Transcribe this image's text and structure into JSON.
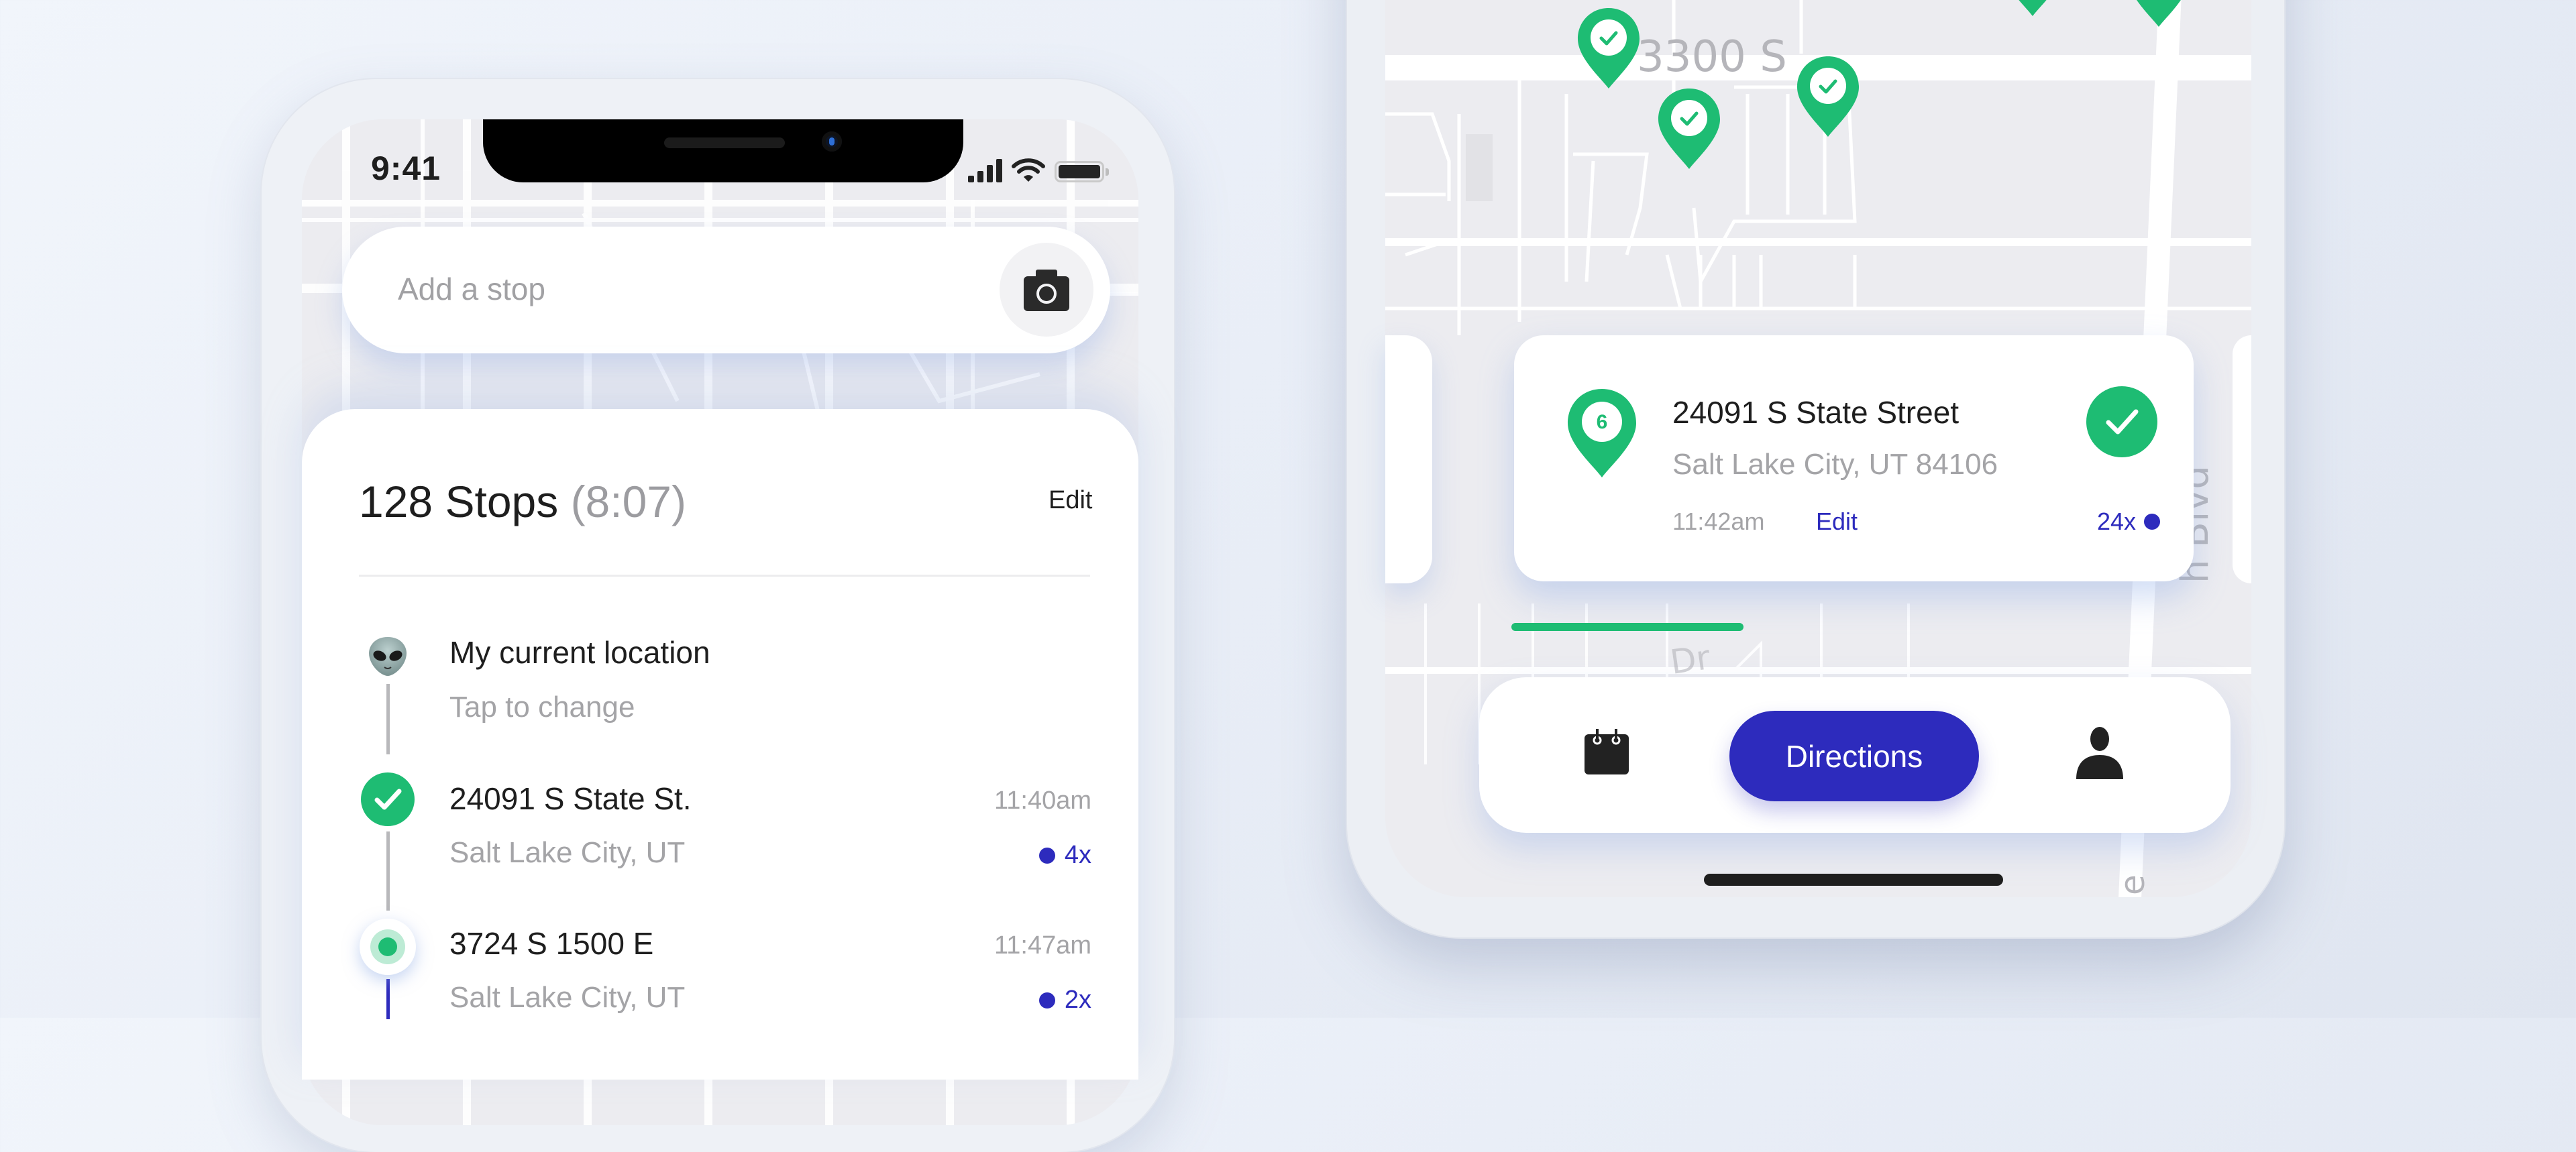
{
  "colors": {
    "accent": "#2d2bbd",
    "success": "#1ebc73",
    "text_primary": "#1e1e1e",
    "text_muted": "#a4a4a7"
  },
  "left_phone": {
    "status_bar": {
      "time": "9:41",
      "icons": [
        "cellular-signal-icon",
        "wifi-icon",
        "battery-icon"
      ]
    },
    "search": {
      "placeholder": "Add a stop",
      "camera_icon": "camera-icon"
    },
    "route": {
      "stops_count": "128 Stops",
      "duration": "(8:07)",
      "edit_label": "Edit"
    },
    "stops": [
      {
        "icon": "alien-emoji-icon",
        "title": "My current location",
        "subtitle": "Tap to change",
        "time": "",
        "count": ""
      },
      {
        "icon": "check-circle-icon",
        "title": "24091 S State St.",
        "subtitle": "Salt Lake City, UT",
        "time": "11:40am",
        "count": "4x"
      },
      {
        "icon": "current-stop-dot-icon",
        "title": "3724 S 1500 E",
        "subtitle": "Salt Lake City, UT",
        "time": "11:47am",
        "count": "2x"
      }
    ]
  },
  "right_phone": {
    "map": {
      "labels": [
        "3300 S",
        "Dr",
        "h Blvd",
        "e"
      ],
      "completed_pins": 6
    },
    "stop_card": {
      "pin_number": "6",
      "title": "24091 S State Street",
      "subtitle": "Salt Lake City, UT 84106",
      "time": "11:42am",
      "edit_label": "Edit",
      "count": "24x",
      "status_icon": "check-circle-icon"
    },
    "progress": 0.34,
    "bottom_nav": {
      "left_icon": "calendar-icon",
      "primary_label": "Directions",
      "right_icon": "person-icon"
    }
  }
}
